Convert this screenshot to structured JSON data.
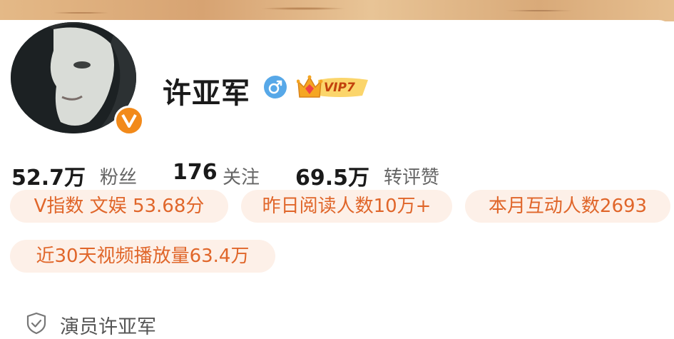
{
  "profile": {
    "name": "许亚军",
    "vip_label": "VIP7",
    "gender_icon": "male-icon",
    "verified_badge_icon": "orange-v-verified-icon"
  },
  "stats": {
    "fans_value": "52.7万",
    "fans_label": "粉丝",
    "following_value": "176",
    "following_label": "关注",
    "likes_value": "69.5万",
    "likes_label": "转评赞"
  },
  "tags": [
    "V指数 文娱 53.68分",
    "昨日阅读人数10万+",
    "本月互动人数2693",
    "近30天视频播放量63.4万"
  ],
  "verification": {
    "icon": "shield-check-icon",
    "text": "演员许亚军"
  },
  "colors": {
    "accent": "#e0662a",
    "pill_bg": "#fdf0e8",
    "vip_gold": "#f5a623",
    "verified_orange": "#f28a1a",
    "gender_blue": "#57a8e8"
  }
}
